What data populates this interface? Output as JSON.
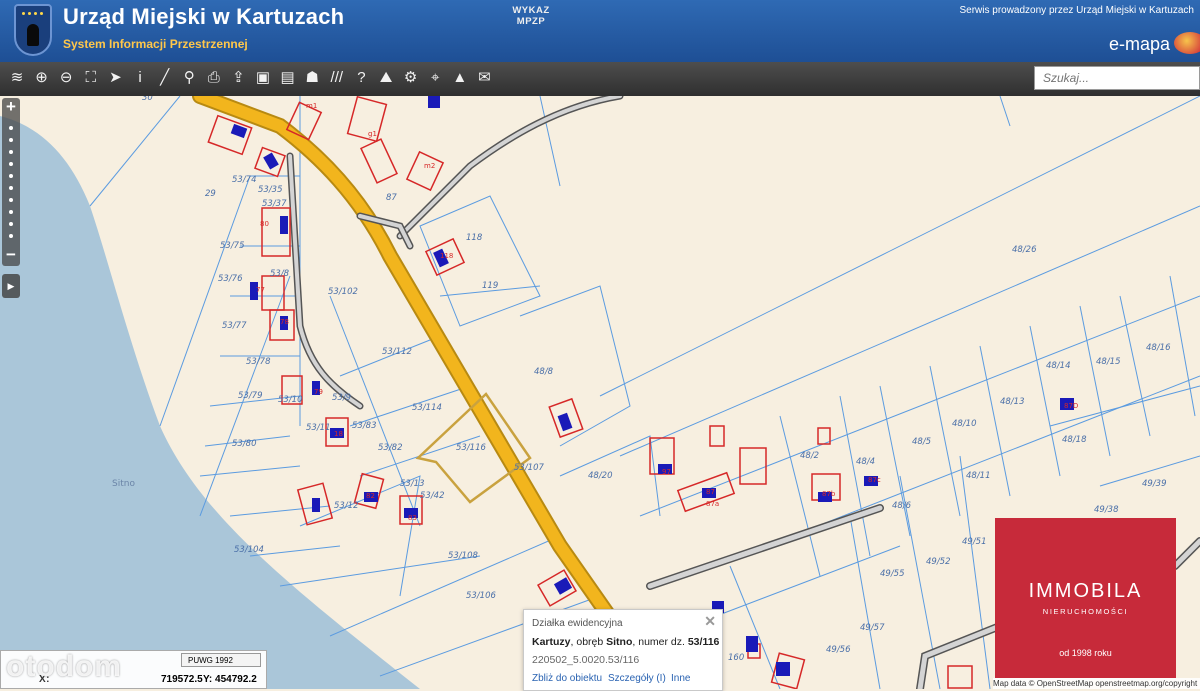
{
  "header": {
    "title": "Urząd Miejski w Kartuzach",
    "subtitle": "System Informacji Przestrzennej",
    "serwis": "Serwis prowadzony przez Urząd Miejski w Kartuzach",
    "logo_text": "e-mapa"
  },
  "toolbar": {
    "tools": [
      "layers-icon",
      "zoom-in-icon",
      "zoom-out-icon",
      "full-extent-icon",
      "pointer-icon",
      "info-icon",
      "measure-line-icon",
      "link-icon",
      "print-icon",
      "export-icon",
      "window-icon",
      "layout-icon",
      "shape-icon",
      "hatch-icon",
      "help-icon",
      "terrain-icon",
      "settings-icon",
      "locate-icon",
      "mountain-icon",
      "chat-icon"
    ],
    "tool_glyphs": [
      "≋",
      "⊕",
      "⊖",
      "⛶",
      "➤",
      "i",
      "╱",
      "⚲",
      "⎙",
      "⇪",
      "▣",
      "▤",
      "☗",
      "///",
      "?",
      "⛰",
      "⚙",
      "⌖",
      "▲",
      "✉"
    ],
    "wykaz_label_1": "WYKAZ",
    "wykaz_label_2": "MPZP"
  },
  "search": {
    "placeholder": "Szukaj..."
  },
  "map": {
    "town_label": "Sitno",
    "parcels": [
      "30",
      "29",
      "53/74",
      "53/35",
      "53/37",
      "53/75",
      "53/76",
      "53/8",
      "53/77",
      "53/78",
      "53/79",
      "53/10",
      "53/80",
      "53/11",
      "53/12",
      "53/104",
      "53/102",
      "53/112",
      "53/114",
      "53/116",
      "53/82",
      "53/13",
      "53/42",
      "53/108",
      "53/106",
      "53/107",
      "53/9",
      "53/83",
      "87",
      "118",
      "119",
      "48/26",
      "48/8",
      "48/20",
      "48/2",
      "48/4",
      "48/5",
      "48/10",
      "48/13",
      "48/14",
      "48/15",
      "48/16",
      "48/18",
      "48/11",
      "48/6",
      "49/39",
      "49/38",
      "49/51",
      "49/52",
      "49/55",
      "49/56",
      "49/57",
      "160"
    ],
    "building_labels": [
      "m2",
      "m1",
      "g1",
      "80",
      "77",
      "78",
      "79",
      "18",
      "82",
      "83",
      "118",
      "87",
      "87a",
      "87b",
      "87c",
      "87D",
      "97"
    ]
  },
  "popup": {
    "title": "Działka ewidencyjna",
    "city": "Kartuzy",
    "obreb_prefix": "obręb",
    "obreb": "Sitno",
    "numer_prefix": "numer dz.",
    "numer": "53/116",
    "identifier": "220502_5.0020.53/116",
    "link_zoom": "Zbliż do obiektu",
    "link_details": "Szczegóły (I)",
    "link_other": "Inne"
  },
  "coords": {
    "system": "PUWG 1992",
    "x_label": "X:",
    "x": "719572.5",
    "y_label": "Y:",
    "y": "454792.2"
  },
  "watermark": "otodom",
  "attribution": "Map data © OpenStreetMap openstreetmap.org/copyright",
  "badge": {
    "name": "IMMOBILA",
    "sub": "NIERUCHOMOŚCI",
    "since": "od 1998 roku",
    "color": "#c72a3a"
  },
  "colors": {
    "road_main": "#f2b51d",
    "road_side": "#9a9a9a",
    "parcel_line": "#5b9be0",
    "building": "#d62828",
    "selection": "#c9a23f",
    "lake": "#aac6d9"
  }
}
